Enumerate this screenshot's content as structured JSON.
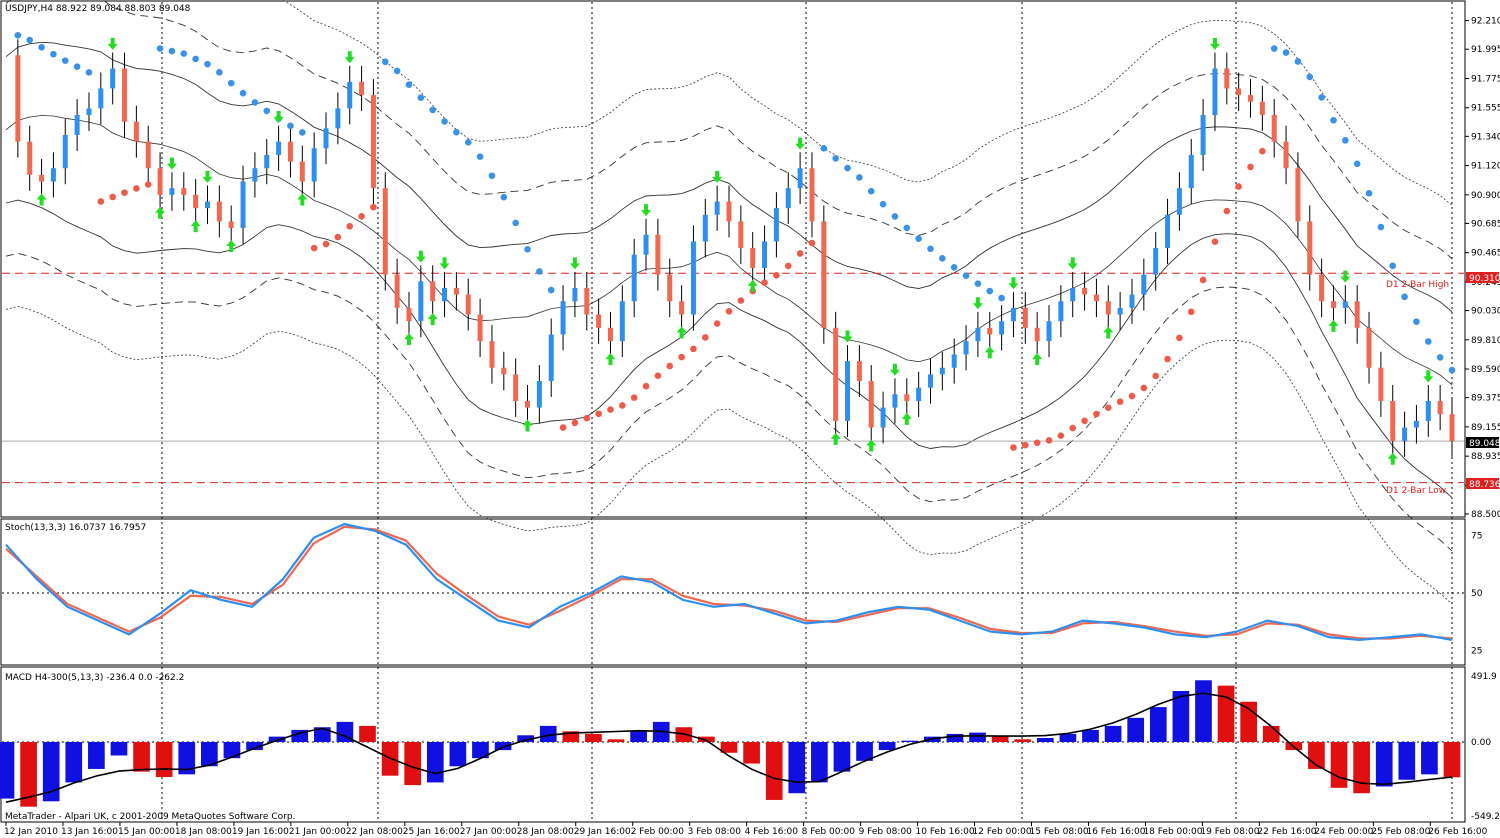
{
  "window": {
    "title": "USDJPY,H4  88.922 89.084 88.803 89.048"
  },
  "copyright": "MetaTrader - Alpari UK, c 2001-2009 MetaQuotes Software Corp.",
  "colors": {
    "bull": "#2e8ff0",
    "bear": "#f06850",
    "sar_up": "#3a92e8",
    "sar_down": "#f05a4a",
    "arrow": "#22dd22",
    "level_line": "#e02020",
    "stoch_main": "#2e8ff0",
    "stoch_signal": "#f06850",
    "macd_pos": "#1010e0",
    "macd_neg": "#e01010"
  },
  "price_axis": {
    "ticks": [
      "92.210",
      "91.995",
      "91.775",
      "91.555",
      "91.340",
      "91.120",
      "90.900",
      "90.685",
      "90.465",
      "90.245",
      "90.030",
      "89.810",
      "89.590",
      "89.375",
      "89.155",
      "88.935",
      "88.715",
      "88.500"
    ],
    "current_price": "89.048",
    "d1_high_value": "90.310",
    "d1_high_label": "D1 2-Bar High",
    "d1_low_value": "88.736",
    "d1_low_label": "D1 2-Bar Low"
  },
  "stoch": {
    "header": "Stoch(13,3,3) 16.0737 16.7957",
    "ticks": [
      "75",
      "50",
      "25"
    ]
  },
  "macd": {
    "header": "MACD H4-300(5,13,3) -236.4 0.0 -262.2",
    "ticks": [
      "491.9",
      "0.00",
      "-549.2"
    ]
  },
  "time_axis": [
    "12 Jan 2010",
    "13 Jan 16:00",
    "15 Jan 00:00",
    "18 Jan 08:00",
    "19 Jan 16:00",
    "21 Jan 00:00",
    "22 Jan 08:00",
    "25 Jan 16:00",
    "27 Jan 00:00",
    "28 Jan 08:00",
    "29 Jan 16:00",
    "2 Feb 00:00",
    "3 Feb 08:00",
    "4 Feb 16:00",
    "8 Feb 00:00",
    "9 Feb 08:00",
    "10 Feb 16:00",
    "12 Feb 00:00",
    "15 Feb 08:00",
    "16 Feb 16:00",
    "18 Feb 00:00",
    "19 Feb 08:00",
    "22 Feb 16:00",
    "24 Feb 00:00",
    "25 Feb 08:00",
    "26 Feb 16:00"
  ],
  "chart_data": {
    "type": "candlestick",
    "symbol": "USDJPY,H4",
    "ohlc_header": "88.922 89.084 88.803 89.048",
    "ylim": [
      88.5,
      92.32
    ],
    "closes": [
      91.95,
      91.3,
      91.05,
      91.0,
      91.1,
      91.35,
      91.5,
      91.55,
      91.7,
      91.85,
      91.45,
      91.3,
      91.1,
      90.9,
      90.95,
      90.9,
      90.8,
      90.85,
      90.7,
      90.65,
      91.0,
      91.1,
      91.2,
      91.3,
      91.15,
      91.0,
      91.25,
      91.4,
      91.55,
      91.75,
      91.65,
      90.95,
      90.3,
      90.05,
      89.95,
      90.25,
      90.1,
      90.2,
      90.15,
      90.0,
      89.8,
      89.6,
      89.55,
      89.35,
      89.3,
      89.5,
      89.85,
      90.1,
      90.2,
      90.0,
      89.9,
      89.8,
      90.1,
      90.45,
      90.6,
      90.3,
      90.1,
      90.0,
      90.55,
      90.75,
      90.85,
      90.7,
      90.5,
      90.35,
      90.55,
      90.8,
      90.95,
      91.1,
      90.7,
      89.9,
      89.2,
      89.65,
      89.5,
      89.15,
      89.3,
      89.4,
      89.35,
      89.45,
      89.55,
      89.6,
      89.7,
      89.8,
      89.9,
      89.85,
      89.95,
      90.05,
      89.9,
      89.8,
      89.95,
      90.1,
      90.2,
      90.15,
      90.1,
      90.0,
      90.05,
      90.15,
      90.3,
      90.5,
      90.75,
      90.95,
      91.2,
      91.5,
      91.85,
      91.7,
      91.65,
      91.6,
      91.5,
      91.3,
      91.1,
      90.7,
      90.3,
      90.1,
      90.05,
      90.1,
      89.9,
      89.6,
      89.35,
      89.05,
      89.15,
      89.2,
      89.35,
      89.25,
      89.05
    ],
    "stoch_main": [
      85,
      60,
      40,
      30,
      20,
      35,
      52,
      45,
      40,
      60,
      90,
      100,
      95,
      85,
      60,
      45,
      30,
      25,
      40,
      50,
      62,
      58,
      45,
      40,
      42,
      35,
      28,
      30,
      36,
      40,
      38,
      30,
      22,
      20,
      22,
      30,
      28,
      25,
      20,
      18,
      22,
      30,
      26,
      18,
      16,
      18,
      20,
      16
    ],
    "stoch_signal": [
      82,
      62,
      42,
      32,
      22,
      32,
      48,
      47,
      42,
      56,
      86,
      98,
      96,
      88,
      64,
      48,
      33,
      27,
      37,
      48,
      60,
      60,
      48,
      42,
      41,
      37,
      30,
      29,
      34,
      39,
      39,
      32,
      24,
      21,
      21,
      28,
      29,
      26,
      22,
      19,
      20,
      28,
      27,
      20,
      17,
      17,
      19,
      17
    ],
    "macd_hist": [
      -420,
      -480,
      -440,
      -300,
      -200,
      -100,
      -220,
      -260,
      -240,
      -180,
      -120,
      -60,
      40,
      90,
      110,
      150,
      120,
      -250,
      -320,
      -300,
      -180,
      -120,
      -60,
      50,
      120,
      80,
      60,
      20,
      80,
      150,
      110,
      40,
      -80,
      -160,
      -430,
      -380,
      -300,
      -220,
      -140,
      -60,
      10,
      40,
      60,
      70,
      40,
      20,
      30,
      60,
      90,
      120,
      180,
      260,
      380,
      460,
      420,
      300,
      120,
      -60,
      -200,
      -340,
      -380,
      -330,
      -280,
      -240,
      -262
    ]
  }
}
